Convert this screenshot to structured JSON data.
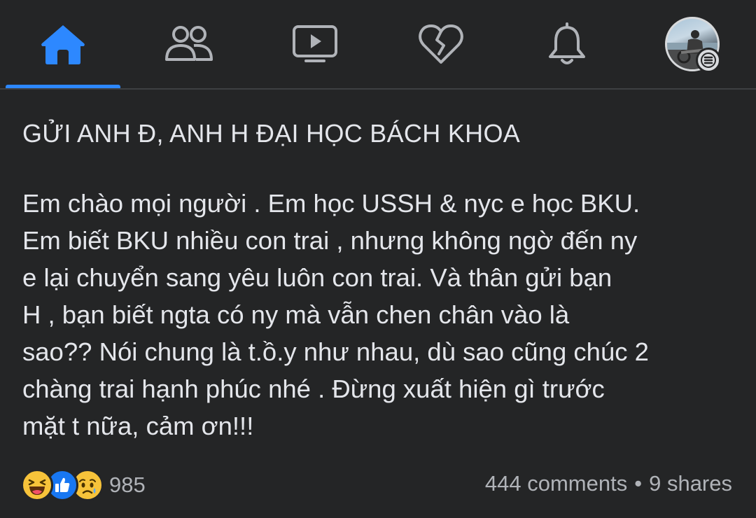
{
  "nav": {
    "items": [
      {
        "name": "home",
        "icon": "home-icon",
        "active": true
      },
      {
        "name": "friends",
        "icon": "friends-icon",
        "active": false
      },
      {
        "name": "watch",
        "icon": "video-icon",
        "active": false
      },
      {
        "name": "dating",
        "icon": "heart-icon",
        "active": false
      },
      {
        "name": "notifications",
        "icon": "bell-icon",
        "active": false
      },
      {
        "name": "menu",
        "icon": "profile-avatar",
        "active": false
      }
    ],
    "accent_color": "#2d88ff"
  },
  "post": {
    "title": "GỬI ANH Đ, ANH H ĐẠI HỌC BÁCH KHOA",
    "lines": [
      "Em chào mọi người . Em học USSH & nyc e học BKU.",
      "Em biết BKU nhiều con trai , nhưng không ngờ đến ny",
      "e lại chuyển sang yêu luôn con trai. Và thân gửi bạn",
      "H , bạn biết ngta có ny mà vẫn chen chân vào là",
      "sao?? Nói chung là t.ồ.y như nhau, dù sao cũng chúc 2",
      "chàng trai hạnh phúc nhé . Đừng xuất hiện gì trước",
      "mặt t nữa, cảm ơn!!!"
    ],
    "reactions": {
      "icons": [
        "haha-icon",
        "like-icon",
        "sad-icon"
      ],
      "count": "985"
    },
    "comments": "444 comments",
    "separator": "•",
    "shares": "9 shares"
  }
}
